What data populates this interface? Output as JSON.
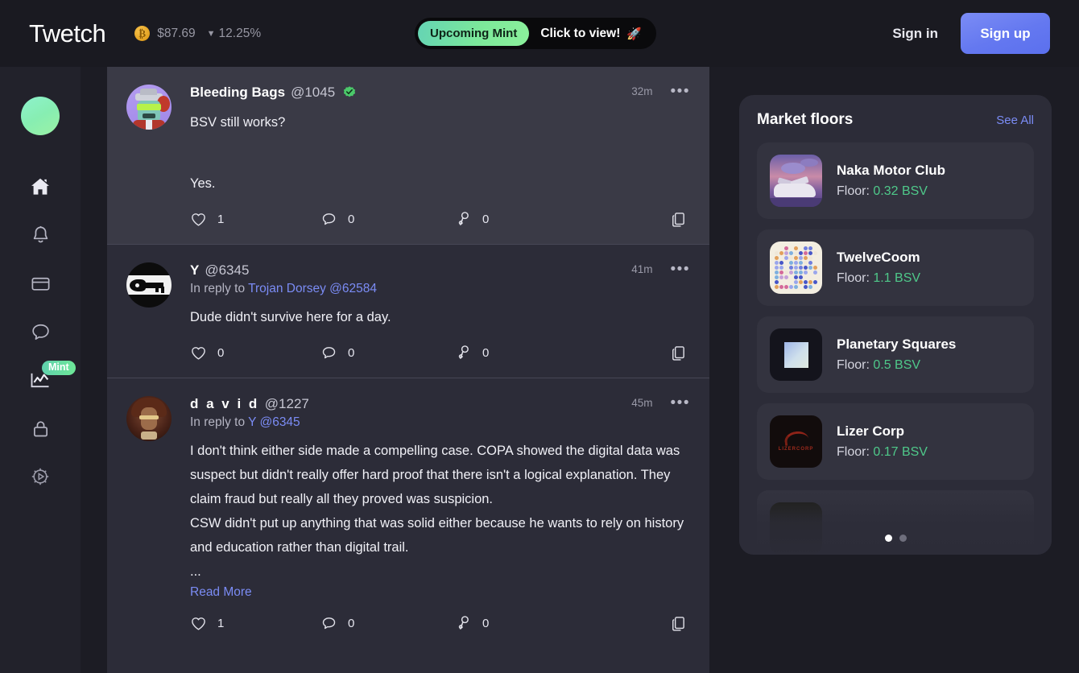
{
  "header": {
    "logo": "Twetch",
    "ticker": {
      "coin_icon": "bitcoin-icon",
      "price": "$87.69",
      "caret": "▼",
      "change": "12.25%"
    },
    "banner": {
      "pill_label": "Upcoming Mint",
      "cta": "Click to view!",
      "rocket": "🚀"
    },
    "sign_in": "Sign in",
    "sign_up": "Sign up"
  },
  "sidebar": {
    "avatar_name": "user-avatar",
    "items": [
      {
        "icon": "home-icon",
        "label": "Home",
        "badge": ""
      },
      {
        "icon": "bell-icon",
        "label": "Notifications",
        "badge": ""
      },
      {
        "icon": "card-icon",
        "label": "Wallet",
        "badge": ""
      },
      {
        "icon": "chat-bubble-icon",
        "label": "Messages",
        "badge": ""
      },
      {
        "icon": "chart-icon",
        "label": "Market",
        "badge": "Mint"
      },
      {
        "icon": "lock-icon",
        "label": "Private",
        "badge": ""
      },
      {
        "icon": "gear-icon",
        "label": "Settings",
        "badge": ""
      }
    ]
  },
  "feed": {
    "posts": [
      {
        "avatar": "bleeding-bags-avatar",
        "display_name": "Bleeding Bags",
        "handle": "@1045",
        "verified": true,
        "time": "32m",
        "more": "•••",
        "reply_to_prefix": "",
        "reply_to_name": "",
        "text": "BSV still works?",
        "text2": "Yes.",
        "read_more": "",
        "likes": "1",
        "comments": "0",
        "branches": "0"
      },
      {
        "avatar": "y-avatar",
        "display_name": "Y",
        "handle": "@6345",
        "verified": false,
        "time": "41m",
        "more": "•••",
        "reply_to_prefix": "In reply to ",
        "reply_to_name": "Trojan Dorsey @62584",
        "text": "Dude didn't survive here for a day.",
        "text2": "",
        "read_more": "",
        "likes": "0",
        "comments": "0",
        "branches": "0"
      },
      {
        "avatar": "david-avatar",
        "display_name": "d a v i d",
        "handle": "@1227",
        "verified": false,
        "time": "45m",
        "more": "•••",
        "reply_to_prefix": "In reply to ",
        "reply_to_name": "Y @6345",
        "text": "I don't think either side made a compelling case. COPA showed the digital data was suspect but didn't really offer hard proof that there isn't a logical explanation. They claim fraud but really all they proved was suspicion.\nCSW didn't put up anything that was solid either because he wants to rely on history and education rather than digital trail.\n...",
        "text2": "",
        "read_more": "Read More",
        "likes": "1",
        "comments": "0",
        "branches": "0"
      }
    ],
    "action_icons": [
      "heart-icon",
      "comment-icon",
      "branch-icon",
      "copy-icon"
    ]
  },
  "market": {
    "title": "Market floors",
    "see_all": "See All",
    "floor_label": "Floor:",
    "items": [
      {
        "name": "Naka Motor Club",
        "floor": "0.32 BSV",
        "thumb": "naka-motor-club-thumbnail"
      },
      {
        "name": "TwelveCoom",
        "floor": "1.1 BSV",
        "thumb": "twelvecoom-thumbnail"
      },
      {
        "name": "Planetary Squares",
        "floor": "0.5 BSV",
        "thumb": "planetary-squares-thumbnail"
      },
      {
        "name": "Lizer Corp",
        "floor": "0.17 BSV",
        "thumb": "lizer-corp-thumbnail"
      }
    ],
    "pager": {
      "total": 2,
      "active": 0
    }
  },
  "colors": {
    "page_bg": "#1c1c24",
    "header_bg": "#1a1a21",
    "sidebar_bg": "#22222b",
    "feed_bg": "#2c2c38",
    "post_elevated_bg": "#3a3a46",
    "card_bg": "#33333f",
    "accent_blue": "#7b8cf5",
    "accent_green": "#4fc98a",
    "mint_green": "#7ce89a",
    "text_primary": "#f0f0f6",
    "text_muted": "#9a9aa8"
  }
}
